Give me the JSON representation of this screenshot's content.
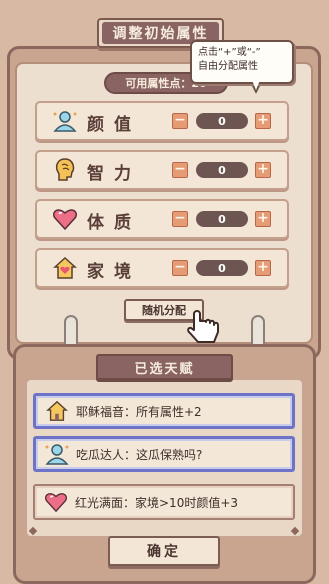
{
  "title": "调整初始属性",
  "points_label": "可用属性点：20",
  "tooltip": {
    "line1": "点击“+”或“-”",
    "line2": "自由分配属性"
  },
  "attributes": [
    {
      "label": "颜值",
      "icon": "face-icon",
      "value": "0",
      "minus": "−",
      "plus": "+"
    },
    {
      "label": "智力",
      "icon": "brain-icon",
      "value": "0",
      "minus": "−",
      "plus": "+"
    },
    {
      "label": "体质",
      "icon": "heart-icon",
      "value": "0",
      "minus": "−",
      "plus": "+"
    },
    {
      "label": "家境",
      "icon": "house-icon",
      "value": "0",
      "minus": "−",
      "plus": "+"
    }
  ],
  "random_button": "随机分配",
  "chosen_title": "已选天赋",
  "talents": [
    {
      "text": "耶稣福音：所有属性+2",
      "icon": "house-icon",
      "style": "selected"
    },
    {
      "text": "吃瓜达人：这瓜保熟吗?",
      "icon": "face-icon",
      "style": "selected"
    },
    {
      "text": "红光满面：家境>10时颜值+3",
      "icon": "heart-icon",
      "style": "plain"
    }
  ],
  "confirm_button": "确定",
  "colors": {
    "accent": "#8a6462",
    "selected_border": "#6d73c7",
    "button": "#e59b74"
  }
}
